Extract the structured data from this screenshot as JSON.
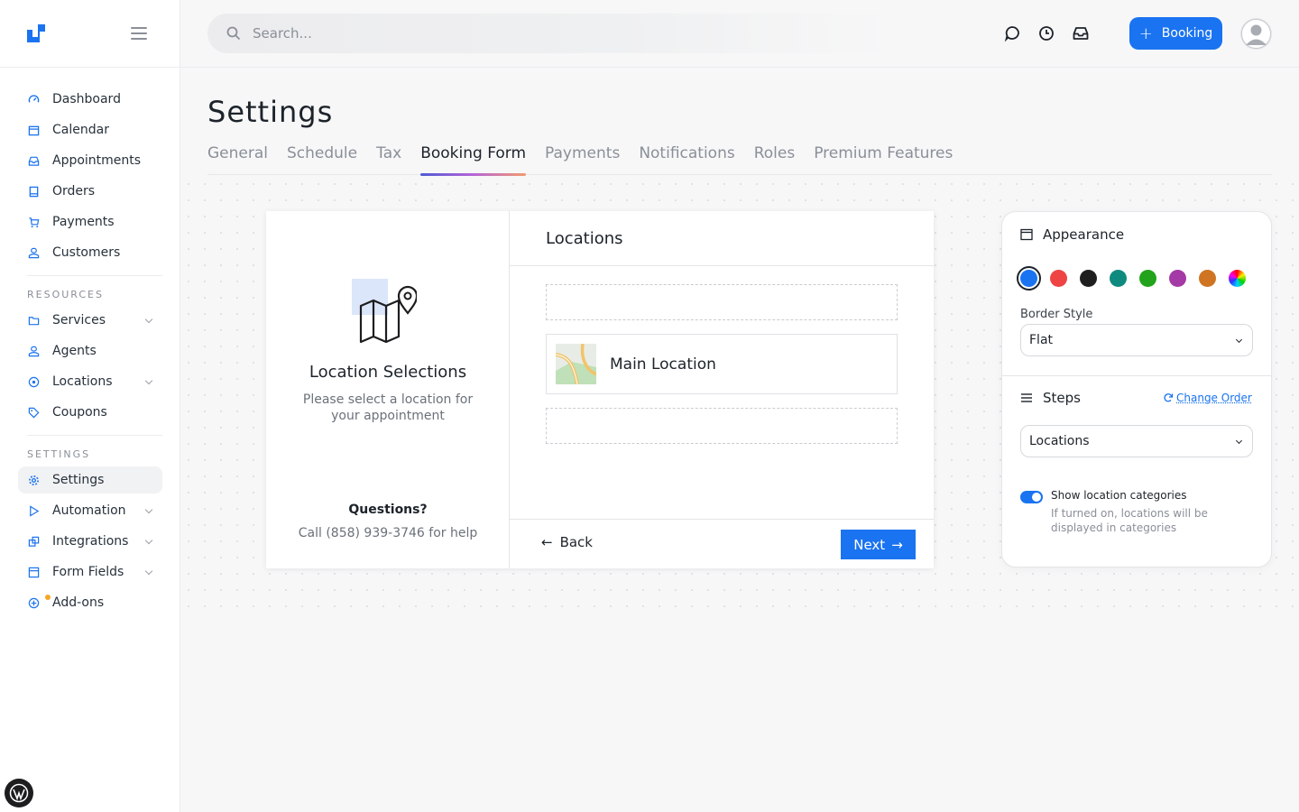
{
  "sidebar": {
    "items": [
      {
        "label": "Dashboard",
        "icon": "dashboard-icon"
      },
      {
        "label": "Calendar",
        "icon": "calendar-icon"
      },
      {
        "label": "Appointments",
        "icon": "inbox-icon"
      },
      {
        "label": "Orders",
        "icon": "receipt-icon"
      },
      {
        "label": "Payments",
        "icon": "cart-icon"
      },
      {
        "label": "Customers",
        "icon": "user-icon"
      }
    ],
    "resources_label": "RESOURCES",
    "resources": [
      {
        "label": "Services",
        "icon": "folder-icon"
      },
      {
        "label": "Agents",
        "icon": "agent-icon"
      },
      {
        "label": "Locations",
        "icon": "pin-icon"
      },
      {
        "label": "Coupons",
        "icon": "tag-icon"
      }
    ],
    "settings_label": "SETTINGS",
    "settings": [
      {
        "label": "Settings",
        "icon": "gear-icon",
        "active": true
      },
      {
        "label": "Automation",
        "icon": "play-icon"
      },
      {
        "label": "Integrations",
        "icon": "integrations-icon"
      },
      {
        "label": "Form Fields",
        "icon": "form-icon"
      },
      {
        "label": "Add-ons",
        "icon": "plus-circle-icon"
      }
    ]
  },
  "topbar": {
    "search_placeholder": "Search...",
    "booking_label": "Booking"
  },
  "page": {
    "title": "Settings",
    "tabs": [
      "General",
      "Schedule",
      "Tax",
      "Booking Form",
      "Payments",
      "Notifications",
      "Roles",
      "Premium Features"
    ],
    "active_tab": "Booking Form"
  },
  "preview": {
    "left_title": "Location Selections",
    "left_sub": "Please select a location for your appointment",
    "questions_title": "Questions?",
    "questions_sub": "Call (858) 939-3746 for help",
    "header": "Locations",
    "location_name": "Main Location",
    "back_label": "Back",
    "next_label": "Next"
  },
  "panel": {
    "appearance_title": "Appearance",
    "colors": [
      "#1a73f0",
      "#ef4444",
      "#1f1f1f",
      "#0f8a7e",
      "#22a31b",
      "#a33aa6",
      "#cf7422",
      "rainbow"
    ],
    "selected_color": "#1a73f0",
    "border_style_label": "Border Style",
    "border_style_value": "Flat",
    "steps_title": "Steps",
    "change_order_label": "Change Order",
    "step_value": "Locations",
    "toggle_title": "Show location categories",
    "toggle_sub": "If turned on, locations will be displayed in categories",
    "toggle_on": true
  }
}
